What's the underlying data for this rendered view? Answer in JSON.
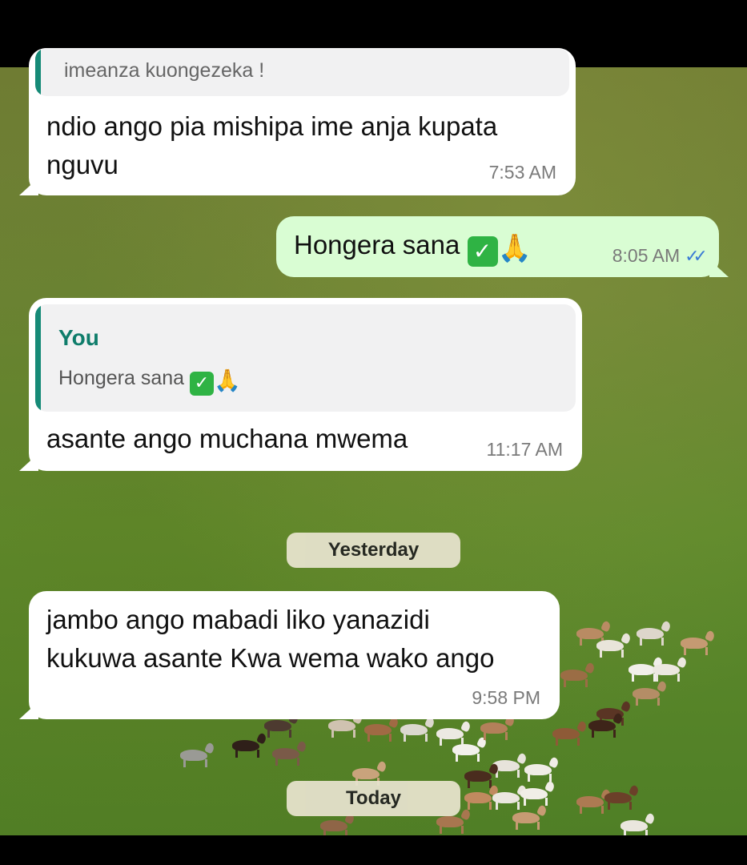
{
  "messages": [
    {
      "id": "m1",
      "direction": "incoming",
      "quoted_fragment": "imeanza kuongezeka !",
      "lines": [
        "ndio ango pia mishipa ime anja kupata",
        "nguvu"
      ],
      "time": "7:53 AM"
    },
    {
      "id": "m2",
      "direction": "outgoing",
      "text": "Hongera sana",
      "emoji": [
        "check-mark-button",
        "folded-hands"
      ],
      "time": "8:05 AM",
      "status": "read"
    },
    {
      "id": "m3",
      "direction": "incoming",
      "reply_to": {
        "author": "You",
        "text": "Hongera sana",
        "emoji": [
          "check-mark-button",
          "folded-hands"
        ]
      },
      "text": "asante ango muchana mwema",
      "time": "11:17 AM"
    },
    {
      "id": "m4",
      "direction": "incoming",
      "lines": [
        "jambo ango mabadi liko yanazidi",
        "kukuwa asante Kwa wema wako ango"
      ],
      "time": "9:58 PM"
    }
  ],
  "date_separators": {
    "yesterday": "Yesterday",
    "today": "Today"
  },
  "glyphs": {
    "check": "✓",
    "pray": "🙏",
    "read_ticks": "✓✓"
  },
  "colors": {
    "incoming_bubble": "#ffffff",
    "outgoing_bubble": "#d9fdd3",
    "quote_accent": "#168a77",
    "read_ticks": "#3a7bd5"
  }
}
